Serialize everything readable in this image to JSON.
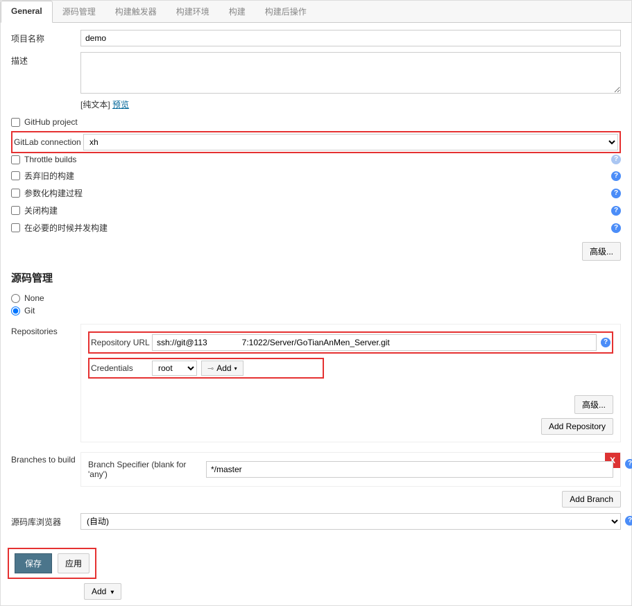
{
  "tabs": [
    "General",
    "源码管理",
    "构建触发器",
    "构建环境",
    "构建",
    "构建后操作"
  ],
  "general": {
    "project_name_lbl": "项目名称",
    "project_name_val": "demo",
    "desc_lbl": "描述",
    "desc_val": "",
    "text_note_prefix": "[纯文本] ",
    "text_note_link": "预览",
    "github_project": "GitHub project",
    "gitlab_conn_lbl": "GitLab connection",
    "gitlab_conn_val": "xh",
    "throttle": "Throttle builds",
    "discard": "丢弃旧的构建",
    "parametrize": "参数化构建过程",
    "disable": "关闭构建",
    "concurrent": "在必要的时候并发构建",
    "advanced_btn": "高级..."
  },
  "scm": {
    "title": "源码管理",
    "none": "None",
    "git": "Git",
    "repos_lbl": "Repositories",
    "repo_url_lbl": "Repository URL",
    "repo_url_val": "ssh://git@113               7:1022/Server/GoTianAnMen_Server.git",
    "cred_lbl": "Credentials",
    "cred_val": "root",
    "add_lbl": "Add",
    "advanced_btn": "高级...",
    "add_repo_btn": "Add Repository",
    "branches_lbl": "Branches to build",
    "branch_spec_lbl": "Branch Specifier (blank for 'any')",
    "branch_spec_val": "*/master",
    "add_branch_btn": "Add Branch",
    "browser_lbl": "源码库浏览器",
    "browser_val": "(自动)"
  },
  "footer": {
    "save": "保存",
    "apply": "应用",
    "add": "Add"
  }
}
